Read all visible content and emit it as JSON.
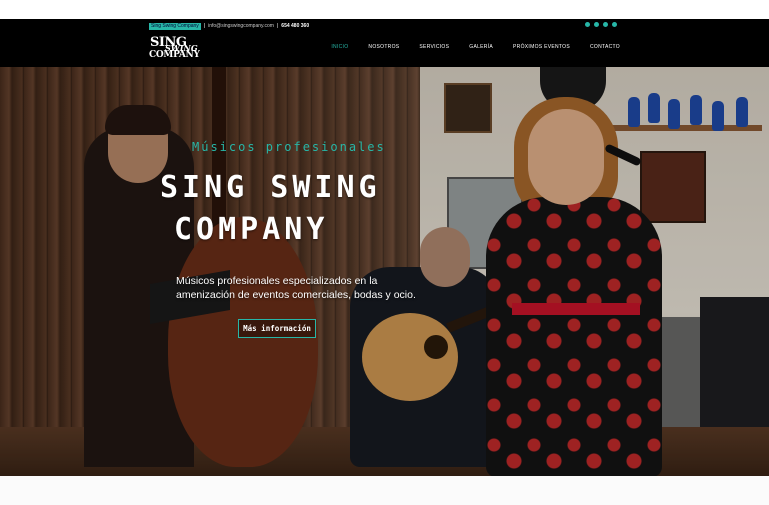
{
  "topbar": {
    "brand": "Sing Swing Company",
    "separator": "|",
    "email": "info@singswingcompany.com",
    "phone": "654 480 360",
    "accent_color": "#27b6a7",
    "socials": [
      "facebook-icon",
      "twitter-icon",
      "youtube-icon",
      "instagram-icon"
    ]
  },
  "logo": {
    "line1": "SING",
    "line2": "SWING",
    "line3": "COMPANY"
  },
  "nav": {
    "items": [
      {
        "label": "INICIO",
        "active": true
      },
      {
        "label": "NOSOTROS"
      },
      {
        "label": "SERVICIOS"
      },
      {
        "label": "GALERÍA"
      },
      {
        "label": "PRÓXIMOS EVENTOS"
      },
      {
        "label": "CONTACTO"
      }
    ]
  },
  "hero": {
    "subtitle": "Músicos profesionales",
    "title_line1": "SING SWING",
    "title_line2": "COMPANY",
    "description": "Músicos profesionales especializados en la amenización de eventos comerciales, bodas y ocio.",
    "cta_label": "Más información"
  }
}
